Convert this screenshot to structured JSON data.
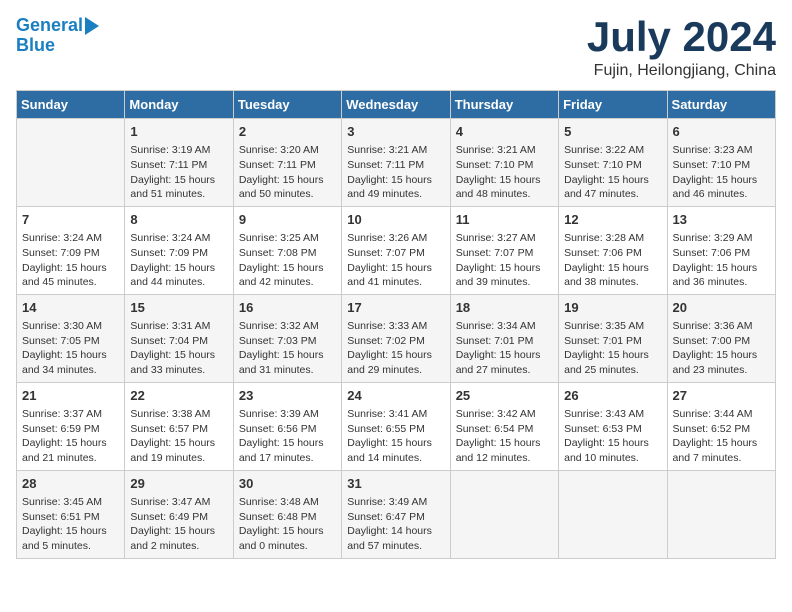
{
  "header": {
    "logo_line1": "General",
    "logo_line2": "Blue",
    "month_title": "July 2024",
    "subtitle": "Fujin, Heilongjiang, China"
  },
  "days_of_week": [
    "Sunday",
    "Monday",
    "Tuesday",
    "Wednesday",
    "Thursday",
    "Friday",
    "Saturday"
  ],
  "weeks": [
    [
      {
        "day": "",
        "info": ""
      },
      {
        "day": "1",
        "info": "Sunrise: 3:19 AM\nSunset: 7:11 PM\nDaylight: 15 hours\nand 51 minutes."
      },
      {
        "day": "2",
        "info": "Sunrise: 3:20 AM\nSunset: 7:11 PM\nDaylight: 15 hours\nand 50 minutes."
      },
      {
        "day": "3",
        "info": "Sunrise: 3:21 AM\nSunset: 7:11 PM\nDaylight: 15 hours\nand 49 minutes."
      },
      {
        "day": "4",
        "info": "Sunrise: 3:21 AM\nSunset: 7:10 PM\nDaylight: 15 hours\nand 48 minutes."
      },
      {
        "day": "5",
        "info": "Sunrise: 3:22 AM\nSunset: 7:10 PM\nDaylight: 15 hours\nand 47 minutes."
      },
      {
        "day": "6",
        "info": "Sunrise: 3:23 AM\nSunset: 7:10 PM\nDaylight: 15 hours\nand 46 minutes."
      }
    ],
    [
      {
        "day": "7",
        "info": "Sunrise: 3:24 AM\nSunset: 7:09 PM\nDaylight: 15 hours\nand 45 minutes."
      },
      {
        "day": "8",
        "info": "Sunrise: 3:24 AM\nSunset: 7:09 PM\nDaylight: 15 hours\nand 44 minutes."
      },
      {
        "day": "9",
        "info": "Sunrise: 3:25 AM\nSunset: 7:08 PM\nDaylight: 15 hours\nand 42 minutes."
      },
      {
        "day": "10",
        "info": "Sunrise: 3:26 AM\nSunset: 7:07 PM\nDaylight: 15 hours\nand 41 minutes."
      },
      {
        "day": "11",
        "info": "Sunrise: 3:27 AM\nSunset: 7:07 PM\nDaylight: 15 hours\nand 39 minutes."
      },
      {
        "day": "12",
        "info": "Sunrise: 3:28 AM\nSunset: 7:06 PM\nDaylight: 15 hours\nand 38 minutes."
      },
      {
        "day": "13",
        "info": "Sunrise: 3:29 AM\nSunset: 7:06 PM\nDaylight: 15 hours\nand 36 minutes."
      }
    ],
    [
      {
        "day": "14",
        "info": "Sunrise: 3:30 AM\nSunset: 7:05 PM\nDaylight: 15 hours\nand 34 minutes."
      },
      {
        "day": "15",
        "info": "Sunrise: 3:31 AM\nSunset: 7:04 PM\nDaylight: 15 hours\nand 33 minutes."
      },
      {
        "day": "16",
        "info": "Sunrise: 3:32 AM\nSunset: 7:03 PM\nDaylight: 15 hours\nand 31 minutes."
      },
      {
        "day": "17",
        "info": "Sunrise: 3:33 AM\nSunset: 7:02 PM\nDaylight: 15 hours\nand 29 minutes."
      },
      {
        "day": "18",
        "info": "Sunrise: 3:34 AM\nSunset: 7:01 PM\nDaylight: 15 hours\nand 27 minutes."
      },
      {
        "day": "19",
        "info": "Sunrise: 3:35 AM\nSunset: 7:01 PM\nDaylight: 15 hours\nand 25 minutes."
      },
      {
        "day": "20",
        "info": "Sunrise: 3:36 AM\nSunset: 7:00 PM\nDaylight: 15 hours\nand 23 minutes."
      }
    ],
    [
      {
        "day": "21",
        "info": "Sunrise: 3:37 AM\nSunset: 6:59 PM\nDaylight: 15 hours\nand 21 minutes."
      },
      {
        "day": "22",
        "info": "Sunrise: 3:38 AM\nSunset: 6:57 PM\nDaylight: 15 hours\nand 19 minutes."
      },
      {
        "day": "23",
        "info": "Sunrise: 3:39 AM\nSunset: 6:56 PM\nDaylight: 15 hours\nand 17 minutes."
      },
      {
        "day": "24",
        "info": "Sunrise: 3:41 AM\nSunset: 6:55 PM\nDaylight: 15 hours\nand 14 minutes."
      },
      {
        "day": "25",
        "info": "Sunrise: 3:42 AM\nSunset: 6:54 PM\nDaylight: 15 hours\nand 12 minutes."
      },
      {
        "day": "26",
        "info": "Sunrise: 3:43 AM\nSunset: 6:53 PM\nDaylight: 15 hours\nand 10 minutes."
      },
      {
        "day": "27",
        "info": "Sunrise: 3:44 AM\nSunset: 6:52 PM\nDaylight: 15 hours\nand 7 minutes."
      }
    ],
    [
      {
        "day": "28",
        "info": "Sunrise: 3:45 AM\nSunset: 6:51 PM\nDaylight: 15 hours\nand 5 minutes."
      },
      {
        "day": "29",
        "info": "Sunrise: 3:47 AM\nSunset: 6:49 PM\nDaylight: 15 hours\nand 2 minutes."
      },
      {
        "day": "30",
        "info": "Sunrise: 3:48 AM\nSunset: 6:48 PM\nDaylight: 15 hours\nand 0 minutes."
      },
      {
        "day": "31",
        "info": "Sunrise: 3:49 AM\nSunset: 6:47 PM\nDaylight: 14 hours\nand 57 minutes."
      },
      {
        "day": "",
        "info": ""
      },
      {
        "day": "",
        "info": ""
      },
      {
        "day": "",
        "info": ""
      }
    ]
  ]
}
